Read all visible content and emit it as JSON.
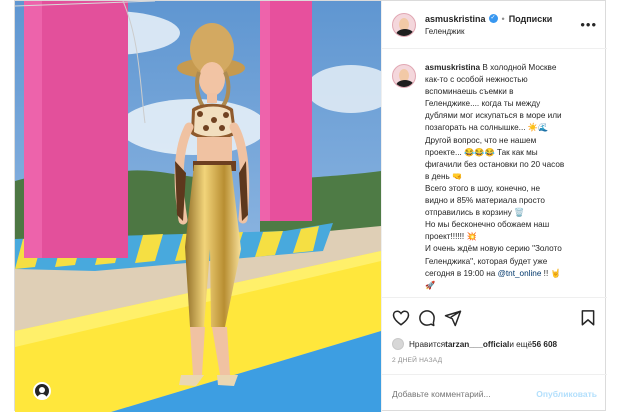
{
  "post": {
    "username": "asmuskristina",
    "follow_label": "Подписки",
    "location": "Геленджик",
    "more": "•••",
    "verified": "✓",
    "separator": "•",
    "caption_lines": [
      "В холодной Москве",
      "как-то с особой нежностью",
      "вспоминаешь съемки в",
      "Геленджике.... когда ты между",
      "дублями мог искупаться в море или",
      "позагорать на солнышке... ☀️🌊",
      "Другой вопрос, что не нашем",
      "проекте... 😂😂😂 Так как мы",
      "фигачили без остановки по 20 часов",
      "в день 🤜",
      "Всего этого в шоу, конечно, не",
      "видно и 85% материала просто",
      "отправились в корзину 🗑️",
      "Но мы бесконечно обожаем наш",
      "проект!!!!!! 💥",
      "И очень ждём новую серию \"Золото",
      "Геленджика\", которая будет уже",
      "сегодня в 19:00 на"
    ],
    "caption_mention": "@tnt_online",
    "caption_tail": " !! 🤘",
    "caption_last": "🚀",
    "likes_prefix": "Нравится ",
    "likes_user": "tarzan___official",
    "likes_and": " и ещё ",
    "likes_count": "56 608",
    "date": "2 дней назад",
    "comment_placeholder": "Добавьте комментарий...",
    "publish_label": "Опубликовать"
  },
  "colors": {
    "sky": "#79a9d8",
    "pink_pillar": "#e9509c",
    "yellow_stage": "#ffe43b",
    "link": "#00376b",
    "verified": "#3897f0"
  },
  "icons": [
    "heart-icon",
    "comment-icon",
    "share-icon",
    "bookmark-icon",
    "more-icon",
    "user-tag-icon"
  ]
}
